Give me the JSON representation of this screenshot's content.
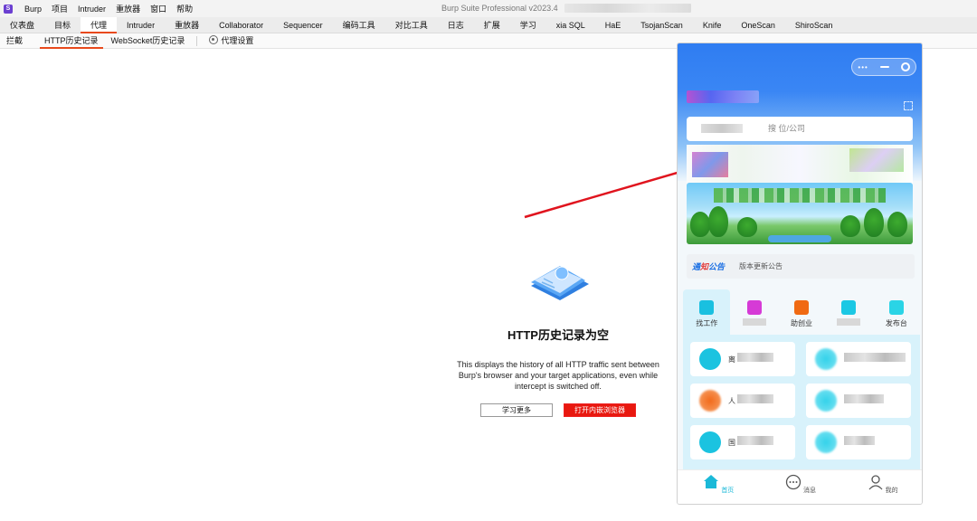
{
  "menubar": {
    "logo": "S",
    "items": [
      "Burp",
      "项目",
      "Intruder",
      "重放器",
      "窗口",
      "帮助"
    ],
    "window_title": "Burp Suite Professional v2023.4"
  },
  "tabs": [
    "仪表盘",
    "目标",
    "代理",
    "Intruder",
    "重放器",
    "Collaborator",
    "Sequencer",
    "编码工具",
    "对比工具",
    "日志",
    "扩展",
    "学习",
    "xia SQL",
    "HaE",
    "TsojanScan",
    "Knife",
    "OneScan",
    "ShiroScan"
  ],
  "active_tab": "代理",
  "subtabs": [
    "拦截",
    "HTTP历史记录",
    "WebSocket历史记录"
  ],
  "active_subtab": "HTTP历史记录",
  "proxy_settings_label": "代理设置",
  "empty_state": {
    "title": "HTTP历史记录为空",
    "description": "This displays the history of all HTTP traffic sent between Burp's browser and your target applications, even while intercept is switched off.",
    "learn_more": "学习更多",
    "open_browser": "打开内嵌浏览器"
  },
  "phone": {
    "search_placeholder": "搜  位/公司",
    "notice_tag_a": "通",
    "notice_tag_b": "知",
    "notice_tag_c": "公告",
    "notice_text": "版本更新公告",
    "categories": [
      {
        "label": "找工作",
        "color": "#19c0e0"
      },
      {
        "label": "",
        "color": "#d63ad6"
      },
      {
        "label": "助创业",
        "color": "#f06a12"
      },
      {
        "label": "",
        "color": "#1bc8e4"
      },
      {
        "label": "发布台",
        "color": "#2ad4e6"
      }
    ],
    "cards": [
      {
        "label": "离"
      },
      {
        "label": ""
      },
      {
        "label": "人"
      },
      {
        "label": ""
      },
      {
        "label": "国"
      },
      {
        "label": ""
      }
    ],
    "nav": [
      "首页",
      "消息",
      "我的"
    ]
  },
  "colors": {
    "accent": "#e8491c",
    "open_button": "#e8180f",
    "phone_blue": "#2f7df2",
    "phone_cyan": "#1bc3e0"
  }
}
